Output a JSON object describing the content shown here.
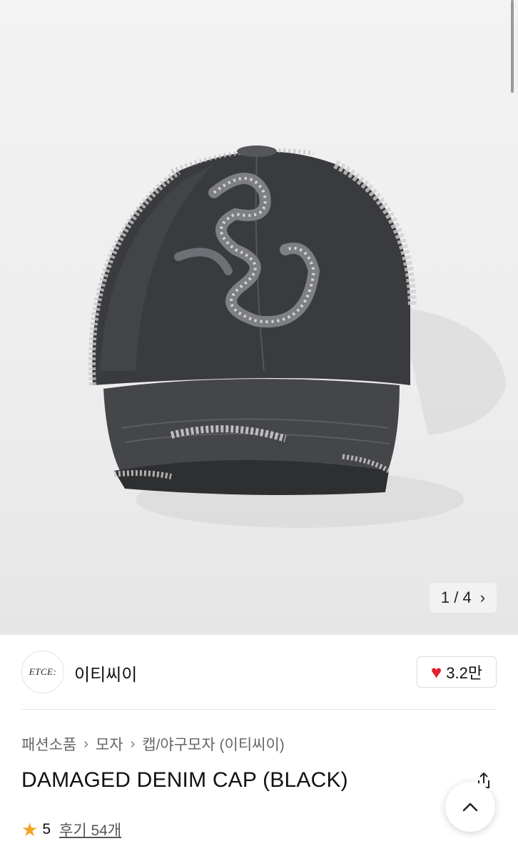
{
  "gallery": {
    "image_alt": "product-image-damaged-denim-cap",
    "current": "1",
    "total": "4",
    "counter_sep": "/",
    "next_icon": "chevron-right-icon"
  },
  "brand": {
    "logo_text": "ETCE:",
    "name": "이티씨이",
    "like_count": "3.2만",
    "like_icon": "heart-icon",
    "like_color": "#e0202a"
  },
  "breadcrumb": {
    "items": [
      "패션소품",
      "모자",
      "캡/야구모자 (이티씨이)"
    ],
    "sep_icon": "chevron-right-icon"
  },
  "product": {
    "title": "DAMAGED DENIM CAP (BLACK)",
    "share_icon": "share-icon",
    "rating": "5",
    "reviews_label": "후기 54개",
    "star_color": "#f2a51f"
  },
  "fab": {
    "icon": "scroll-top-icon"
  }
}
